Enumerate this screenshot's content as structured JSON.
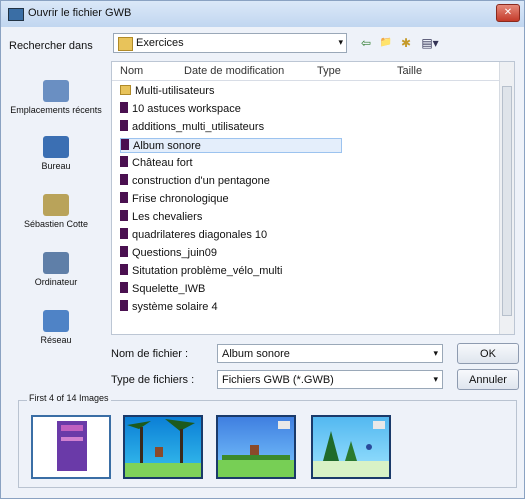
{
  "window": {
    "title": "Ouvrir le fichier GWB",
    "close_glyph": "✕"
  },
  "lookin": {
    "label": "Rechercher dans",
    "value": "Exercices",
    "arrow": "▾"
  },
  "toolbar": {
    "back": "⇦",
    "up": "📁",
    "newfolder": "✱",
    "views": "▤▾"
  },
  "places": [
    {
      "label": "Emplacements récents",
      "icon": "recent-places-icon",
      "color": "#6a8fc2"
    },
    {
      "label": "Bureau",
      "icon": "desktop-icon",
      "color": "#3b6fb3"
    },
    {
      "label": "Sébastien Cotte",
      "icon": "user-folder-icon",
      "color": "#b9a35a"
    },
    {
      "label": "Ordinateur",
      "icon": "computer-icon",
      "color": "#5f7fa8"
    },
    {
      "label": "Réseau",
      "icon": "network-icon",
      "color": "#4f83c6"
    }
  ],
  "columns": {
    "name": "Nom",
    "date": "Date de modification",
    "type": "Type",
    "size": "Taille"
  },
  "files": [
    {
      "name": "Multi-utilisateurs",
      "kind": "folder"
    },
    {
      "name": "10 astuces workspace",
      "kind": "file"
    },
    {
      "name": "additions_multi_utilisateurs",
      "kind": "file"
    },
    {
      "name": "Album sonore",
      "kind": "file",
      "selected": true
    },
    {
      "name": "Château fort",
      "kind": "file"
    },
    {
      "name": "construction d'un pentagone",
      "kind": "file"
    },
    {
      "name": "Frise chronologique",
      "kind": "file"
    },
    {
      "name": "Les chevaliers",
      "kind": "file"
    },
    {
      "name": "quadrilateres diagonales 10",
      "kind": "file"
    },
    {
      "name": "Questions_juin09",
      "kind": "file"
    },
    {
      "name": "Situtation problème_vélo_multi",
      "kind": "file"
    },
    {
      "name": "Squelette_IWB",
      "kind": "file"
    },
    {
      "name": "système solaire 4",
      "kind": "file"
    }
  ],
  "filename": {
    "label": "Nom de fichier :",
    "value": "Album sonore"
  },
  "filetype": {
    "label": "Type de fichiers :",
    "value": "Fichiers GWB (*.GWB)"
  },
  "buttons": {
    "ok": "OK",
    "cancel": "Annuler"
  },
  "preview": {
    "legend": "First 4 of 14 Images"
  }
}
